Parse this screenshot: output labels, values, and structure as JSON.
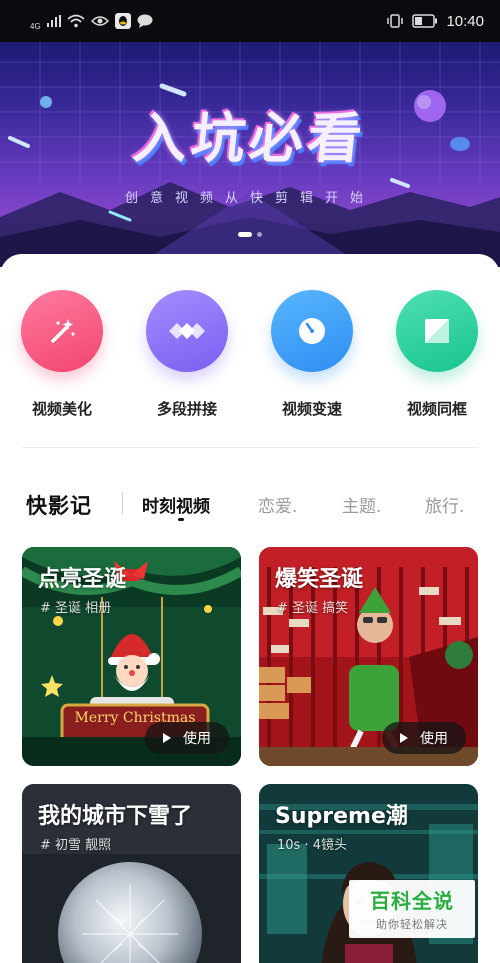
{
  "status_bar": {
    "network": "4G",
    "time": "10:40",
    "icons": [
      "signal-icon",
      "wifi-icon",
      "eye-icon",
      "qq-icon",
      "chat-bubble-icon",
      "vibrate-icon",
      "battery-icon"
    ]
  },
  "banner": {
    "title": "入坑必看",
    "subtitle": "创意视频从快剪辑开始",
    "page_count": 2,
    "active_page": 1
  },
  "tools": [
    {
      "label": "视频美化",
      "icon": "magic-wand-icon",
      "color": "#f2456e"
    },
    {
      "label": "多段拼接",
      "icon": "splice-icon",
      "color": "#7a5ef0"
    },
    {
      "label": "视频变速",
      "icon": "speedometer-icon",
      "color": "#2f8ef2"
    },
    {
      "label": "视频同框",
      "icon": "split-frame-icon",
      "color": "#18c48f"
    }
  ],
  "tabs": {
    "brand": "快影记",
    "items": [
      {
        "label": "时刻视频",
        "active": true
      },
      {
        "label": "恋爱.",
        "active": false
      },
      {
        "label": "主题.",
        "active": false
      },
      {
        "label": "旅行.",
        "active": false
      }
    ]
  },
  "cards": [
    {
      "title": "点亮圣诞",
      "tag": "# 圣诞 相册",
      "button": "使用",
      "sign": "Merry Christmas"
    },
    {
      "title": "爆笑圣诞",
      "tag": "# 圣诞 搞笑",
      "button": "使用"
    },
    {
      "title": "我的城市下雪了",
      "tag": "# 初雪 靓照"
    },
    {
      "title": "Supreme潮",
      "tag": "10s · 4镜头"
    }
  ],
  "watermark": {
    "title": "百科全说",
    "subtitle": "助你轻松解决"
  }
}
